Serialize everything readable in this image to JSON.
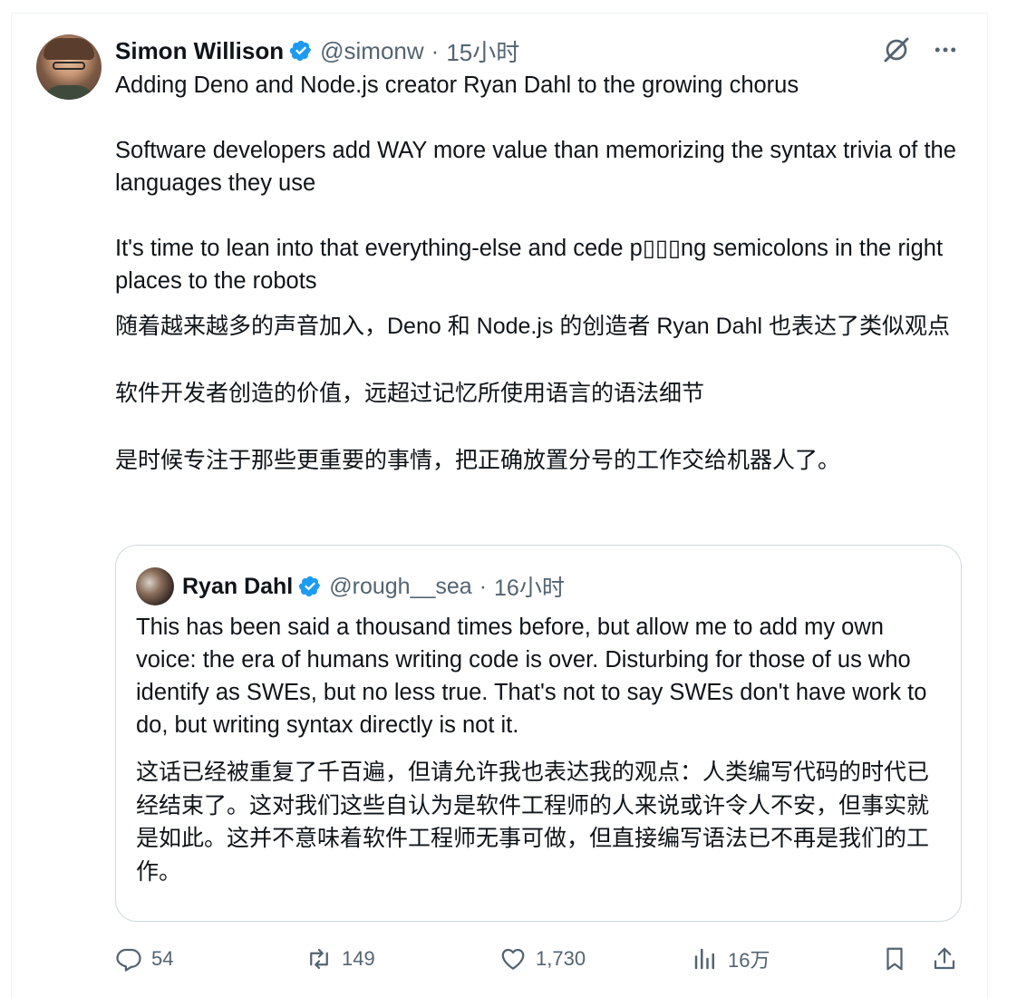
{
  "tweet": {
    "author_name": "Simon Willison",
    "author_handle": "@simonw",
    "time": "15小时",
    "paragraphs": [
      "Adding Deno and Node.js creator Ryan Dahl to the growing chorus",
      "Software developers add WAY more value than memorizing the syntax trivia of the languages they use",
      "It's time to lean into that everything-else and cede p▯▯▯ng semicolons in the right places to the robots"
    ],
    "translation": [
      "随着越来越多的声音加入，Deno 和 Node.js 的创造者 Ryan Dahl 也表达了类似观点",
      "软件开发者创造的价值，远超过记忆所使用语言的语法细节",
      "是时候专注于那些更重要的事情，把正确放置分号的工作交给机器人了。"
    ]
  },
  "quote": {
    "author_name": "Ryan Dahl",
    "author_handle": "@rough__sea",
    "time": "16小时",
    "text": "This has been said a thousand times before, but allow me to add my own voice: the era of humans writing code is over. Disturbing for those of us who identify as SWEs, but no less true. That's not to say SWEs don't have work to do, but writing syntax directly is not it.",
    "translation": "这话已经被重复了千百遍，但请允许我也表达我的观点：人类编写代码的时代已经结束了。这对我们这些自认为是软件工程师的人来说或许令人不安，但事实就是如此。这并不意味着软件工程师无事可做，但直接编写语法已不再是我们的工作。"
  },
  "actions": {
    "replies": "54",
    "reposts": "149",
    "likes": "1,730",
    "views": "16万"
  },
  "icons": {
    "verified_color": "#1d9bf0",
    "muted_color": "#536471"
  }
}
